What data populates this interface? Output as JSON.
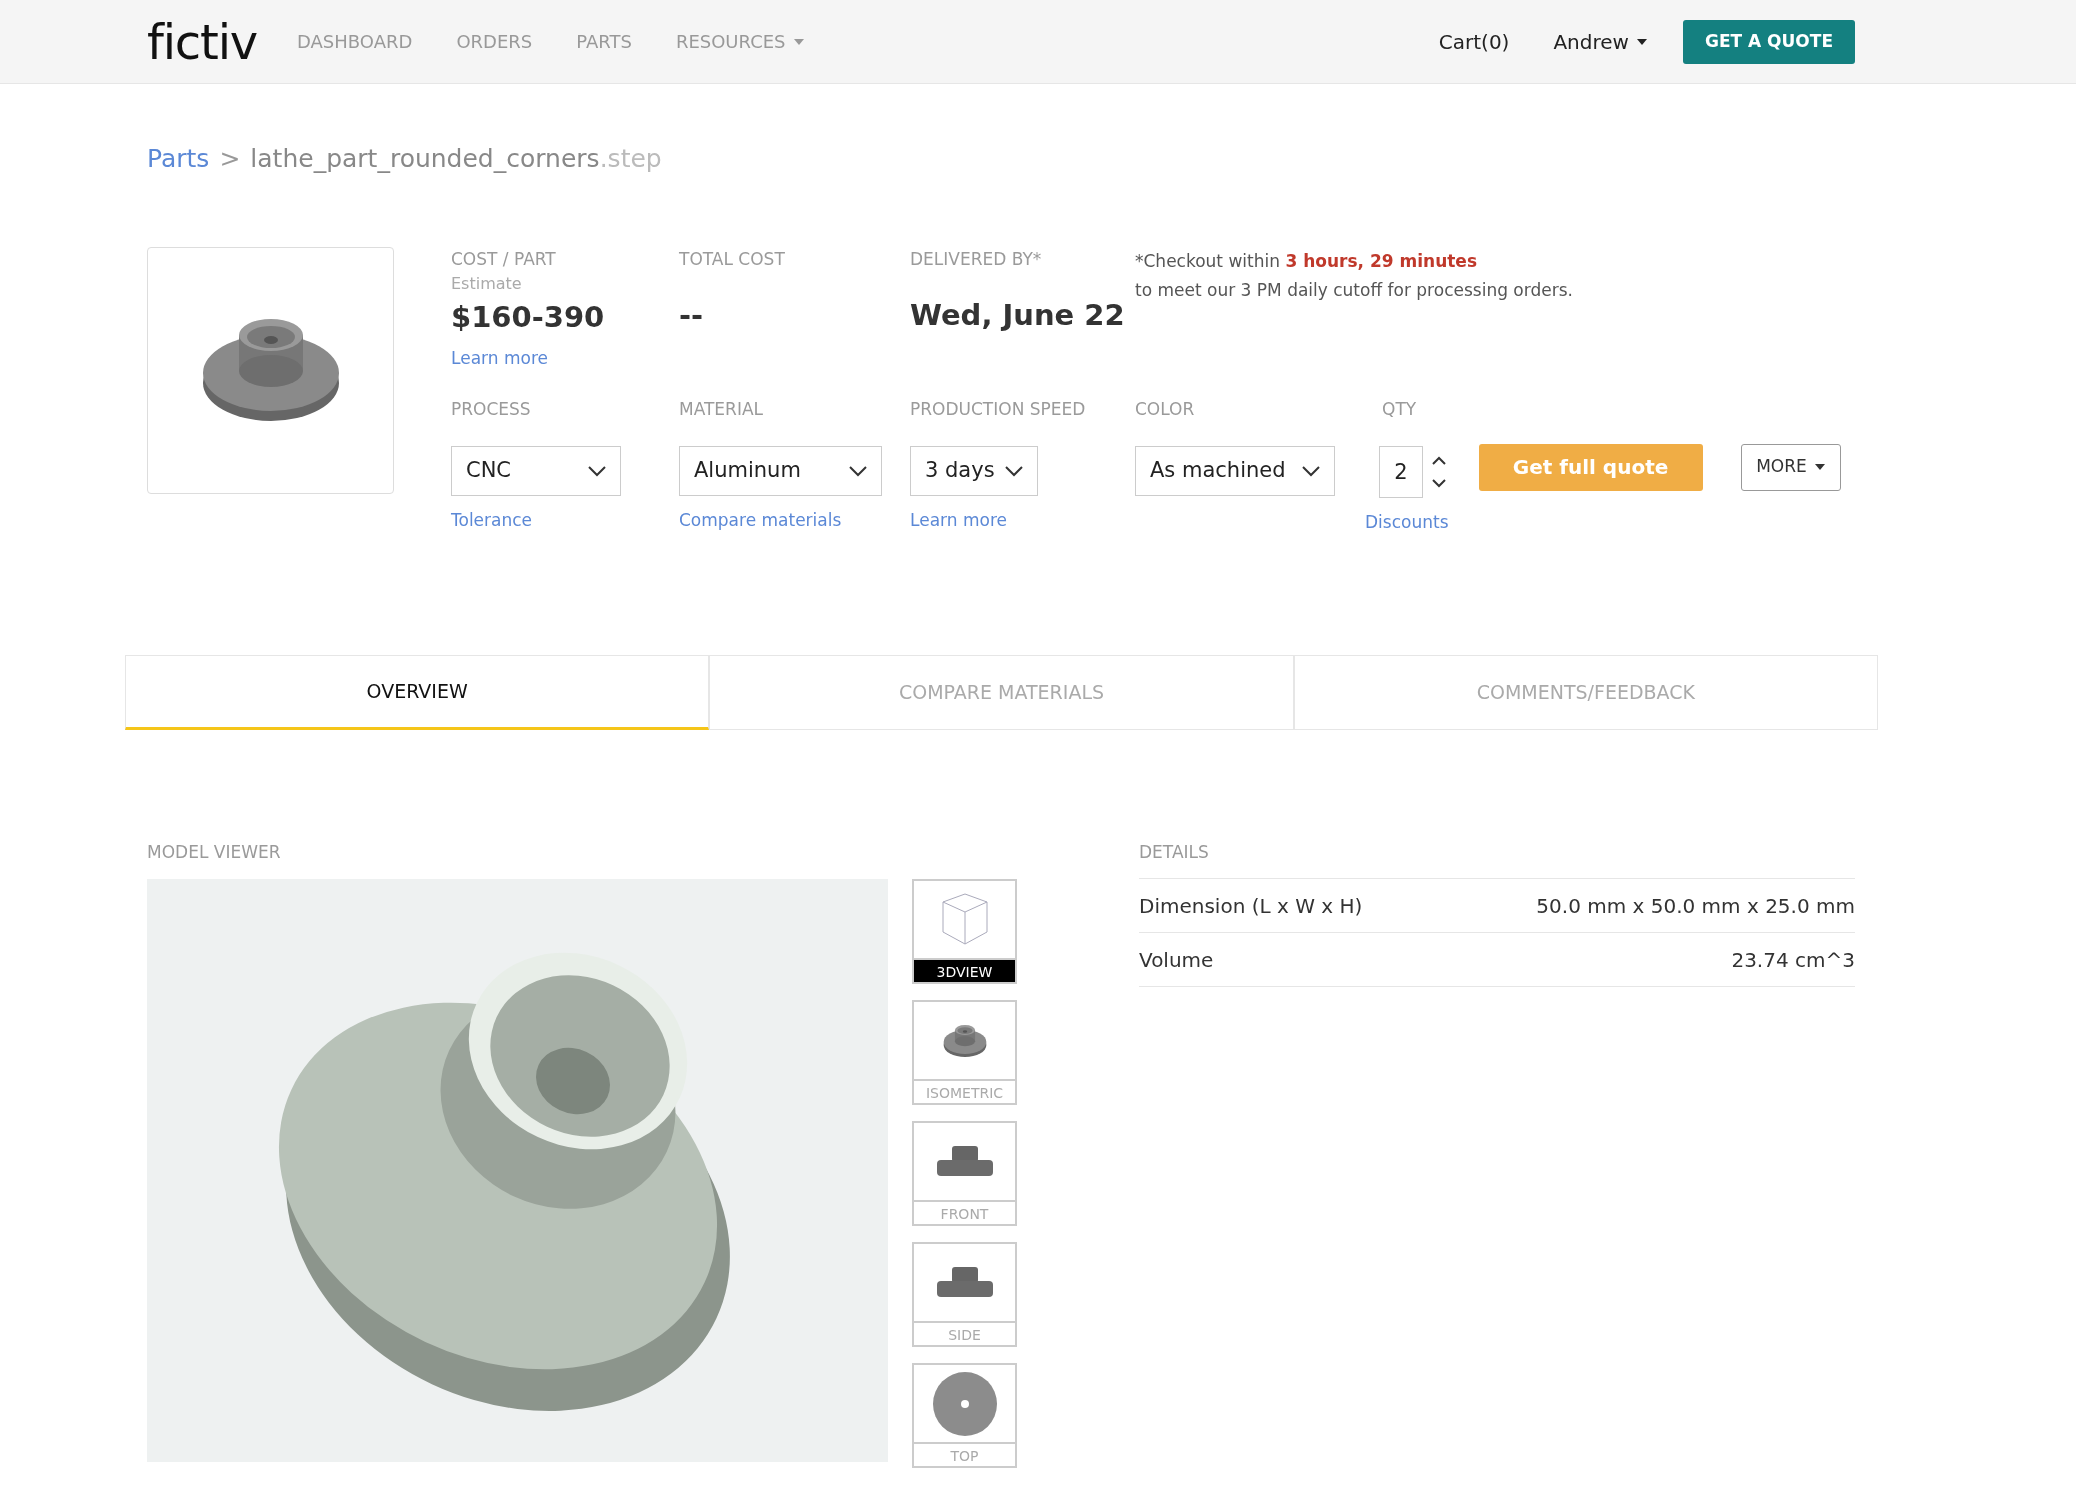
{
  "header": {
    "logo": "fictiv",
    "nav": [
      {
        "label": "DASHBOARD",
        "dropdown": false
      },
      {
        "label": "ORDERS",
        "dropdown": false
      },
      {
        "label": "PARTS",
        "dropdown": false
      },
      {
        "label": "RESOURCES",
        "dropdown": true
      }
    ],
    "cart": "Cart(0)",
    "user": "Andrew",
    "cta": "GET A QUOTE"
  },
  "breadcrumb": {
    "parent": "Parts",
    "separator": ">",
    "name": "lathe_part_rounded_corners",
    "extension": ".step"
  },
  "summary": {
    "cost_label": "COST / PART",
    "cost_note": "Estimate",
    "cost": "$160-390",
    "cost_link": "Learn more",
    "total_label": "TOTAL COST",
    "total": "--",
    "delivered_label": "DELIVERED BY*",
    "delivered": "Wed, June 22",
    "checkout_prefix": "*Checkout within",
    "checkout_time": "3 hours, 29 minutes",
    "checkout_rest": "to meet our 3 PM daily cutoff for processing orders."
  },
  "options": [
    {
      "label": "PROCESS",
      "value": "CNC",
      "link": "Tolerance"
    },
    {
      "label": "MATERIAL",
      "value": "Aluminum",
      "link": "Compare materials"
    },
    {
      "label": "PRODUCTION SPEED",
      "value": "3 days",
      "link": "Learn more"
    },
    {
      "label": "COLOR",
      "value": "As machined"
    }
  ],
  "qty": {
    "label": "QTY",
    "value": "2",
    "link": "Discounts"
  },
  "quote_button": "Get full quote",
  "more_button": "MORE",
  "tabs": [
    {
      "label": "OVERVIEW",
      "selected": true
    },
    {
      "label": "COMPARE MATERIALS",
      "selected": false
    },
    {
      "label": "COMMENTS/FEEDBACK",
      "selected": false
    }
  ],
  "model_viewer": {
    "title": "MODEL VIEWER",
    "views": [
      {
        "label": "3DVIEW",
        "kind": "cube",
        "selected": true
      },
      {
        "label": "ISOMETRIC",
        "kind": "iso",
        "selected": false
      },
      {
        "label": "FRONT",
        "kind": "profile",
        "selected": false
      },
      {
        "label": "SIDE",
        "kind": "profile",
        "selected": false
      },
      {
        "label": "TOP",
        "kind": "top",
        "selected": false
      }
    ]
  },
  "details": {
    "title": "DETAILS",
    "rows": [
      {
        "name": "Dimension (L x W x H)",
        "value": "50.0 mm x 50.0 mm x 25.0 mm"
      },
      {
        "name": "Volume",
        "value": "23.74 cm^3"
      }
    ]
  }
}
